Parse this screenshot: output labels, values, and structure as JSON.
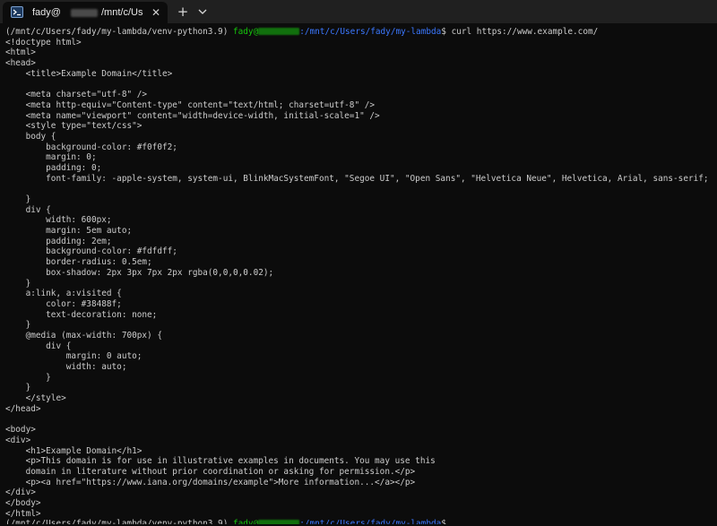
{
  "tab": {
    "title": "fady@",
    "path": "/mnt/c/Us",
    "close_glyph": "✕"
  },
  "toolbar": {
    "new_tab_glyph": "+",
    "dropdown_icon": "chevron-down-icon"
  },
  "prompt": {
    "env": "(/mnt/c/Users/fady/my-lambda/venv-python3.9) ",
    "user": "fady@",
    "path": ":/mnt/c/Users/fady/my-lambda",
    "symbol": "$"
  },
  "command": " curl https://www.example.com/",
  "output": [
    "<!doctype html>",
    "<html>",
    "<head>",
    "    <title>Example Domain</title>",
    "",
    "    <meta charset=\"utf-8\" />",
    "    <meta http-equiv=\"Content-type\" content=\"text/html; charset=utf-8\" />",
    "    <meta name=\"viewport\" content=\"width=device-width, initial-scale=1\" />",
    "    <style type=\"text/css\">",
    "    body {",
    "        background-color: #f0f0f2;",
    "        margin: 0;",
    "        padding: 0;",
    "        font-family: -apple-system, system-ui, BlinkMacSystemFont, \"Segoe UI\", \"Open Sans\", \"Helvetica Neue\", Helvetica, Arial, sans-serif;",
    "",
    "    }",
    "    div {",
    "        width: 600px;",
    "        margin: 5em auto;",
    "        padding: 2em;",
    "        background-color: #fdfdff;",
    "        border-radius: 0.5em;",
    "        box-shadow: 2px 3px 7px 2px rgba(0,0,0,0.02);",
    "    }",
    "    a:link, a:visited {",
    "        color: #38488f;",
    "        text-decoration: none;",
    "    }",
    "    @media (max-width: 700px) {",
    "        div {",
    "            margin: 0 auto;",
    "            width: auto;",
    "        }",
    "    }",
    "    </style>",
    "</head>",
    "",
    "<body>",
    "<div>",
    "    <h1>Example Domain</h1>",
    "    <p>This domain is for use in illustrative examples in documents. You may use this",
    "    domain in literature without prior coordination or asking for permission.</p>",
    "    <p><a href=\"https://www.iana.org/domains/example\">More information...</a></p>",
    "</div>",
    "</body>",
    "</html>"
  ],
  "colors": {
    "background": "#0c0c0c",
    "tabbar": "#202020",
    "text": "#cccccc",
    "user_green": "#16c60c",
    "path_blue": "#3b78ff"
  }
}
